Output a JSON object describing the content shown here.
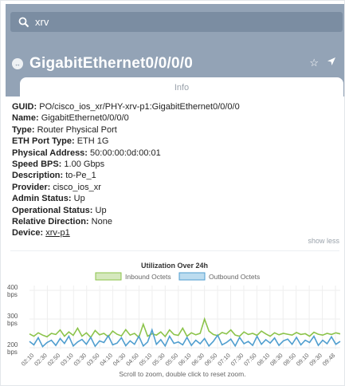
{
  "search": {
    "query": "xrv",
    "icon": "search-icon"
  },
  "header": {
    "title": "GigabitEthernet0/0/0/0",
    "actions": {
      "favorite_icon": "star-icon",
      "locate_icon": "send-arrow-icon"
    },
    "colors": {
      "bar": "#93a3b6",
      "search": "#7b8da2"
    }
  },
  "tab": {
    "label": "Info"
  },
  "properties": [
    {
      "key": "GUID:",
      "value": "PO/cisco_ios_xr/PHY-xrv-p1:GigabitEthernet0/0/0/0"
    },
    {
      "key": "Name:",
      "value": "GigabitEthernet0/0/0/0"
    },
    {
      "key": "Type:",
      "value": "Router Physical Port"
    },
    {
      "key": "ETH Port Type:",
      "value": "ETH 1G"
    },
    {
      "key": "Physical Address:",
      "value": "50:00:00:0d:00:01"
    },
    {
      "key": "Speed BPS:",
      "value": "1.00 Gbps"
    },
    {
      "key": "Description:",
      "value": "to-Pe_1"
    },
    {
      "key": "Provider:",
      "value": "cisco_ios_xr"
    },
    {
      "key": "Admin Status:",
      "value": "Up"
    },
    {
      "key": "Operational Status:",
      "value": "Up"
    },
    {
      "key": "Relative Direction:",
      "value": "None"
    },
    {
      "key": "Device:",
      "value": "xrv-p1",
      "link": true
    }
  ],
  "show_less_label": "show less",
  "chart_data": {
    "type": "line",
    "title": "Utilization Over 24h",
    "footer": "Scroll to zoom, double click to reset zoom.",
    "ylim": [
      200,
      400
    ],
    "y_ticks": [
      {
        "value": 400,
        "label": "400",
        "unit": "bps"
      },
      {
        "value": 300,
        "label": "300",
        "unit": "bps"
      },
      {
        "value": 200,
        "label": "200",
        "unit": "bps"
      }
    ],
    "x_labels": [
      "02:10",
      "02:30",
      "02:50",
      "03:10",
      "03:30",
      "03:50",
      "04:10",
      "04:30",
      "04:50",
      "05:10",
      "05:30",
      "05:50",
      "06:10",
      "06:30",
      "06:50",
      "07:10",
      "07:30",
      "07:50",
      "08:10",
      "08:30",
      "08:50",
      "09:10",
      "09:30",
      "09:48"
    ],
    "grid": true,
    "legend_position": "top",
    "series": [
      {
        "name": "Inbound Octets",
        "color": "#8bc34a",
        "fill": "#d5e8bd",
        "values": [
          248,
          240,
          252,
          244,
          238,
          250,
          246,
          262,
          240,
          255,
          243,
          268,
          240,
          252,
          236,
          260,
          245,
          250,
          238,
          258,
          247,
          241,
          263,
          244,
          250,
          236,
          282,
          240,
          249,
          244,
          255,
          239,
          262,
          246,
          243,
          268,
          240,
          252,
          245,
          250,
          300,
          258,
          246,
          242,
          253,
          248,
          262,
          244,
          240,
          255,
          246,
          250,
          243,
          258,
          248,
          240,
          252,
          245,
          250,
          247,
          244,
          253,
          246,
          249,
          240,
          254,
          247,
          244,
          250,
          246,
          252,
          248
        ]
      },
      {
        "name": "Outbound Octets",
        "color": "#4f9ecf",
        "fill": "#bcdcef",
        "values": [
          222,
          210,
          235,
          204,
          218,
          226,
          208,
          232,
          215,
          240,
          206,
          220,
          229,
          212,
          236,
          205,
          224,
          218,
          242,
          210,
          216,
          235,
          207,
          224,
          212,
          240,
          206,
          220,
          262,
          212,
          228,
          206,
          240,
          215,
          220,
          210,
          236,
          208,
          226,
          214,
          232,
          206,
          222,
          244,
          210,
          218,
          230,
          206,
          236,
          214,
          222,
          208,
          240,
          212,
          228,
          216,
          234,
          208,
          224,
          230,
          212,
          236,
          210,
          226,
          218,
          240,
          208,
          226,
          214,
          238,
          212,
          222
        ]
      }
    ]
  }
}
